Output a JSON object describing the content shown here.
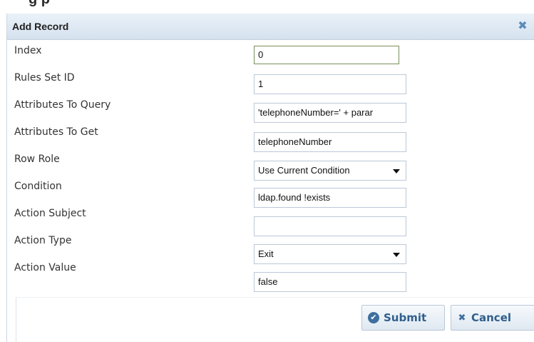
{
  "page": {
    "partial_heading": "g     p"
  },
  "dialog": {
    "title": "Add Record",
    "close_icon": "close-icon"
  },
  "fields": [
    {
      "label": "Index",
      "value": "0",
      "type": "text"
    },
    {
      "label": "Rules Set ID",
      "value": "1",
      "type": "text"
    },
    {
      "label": "Attributes To Query",
      "value": "'telephoneNumber=' + parar",
      "type": "text"
    },
    {
      "label": "Attributes To Get",
      "value": "telephoneNumber",
      "type": "text"
    },
    {
      "label": "Row Role",
      "value": "Use Current Condition",
      "type": "select"
    },
    {
      "label": "Condition",
      "value": "ldap.found !exists",
      "type": "text"
    },
    {
      "label": "Action Subject",
      "value": "",
      "type": "text"
    },
    {
      "label": "Action Type",
      "value": "Exit",
      "type": "select"
    },
    {
      "label": "Action Value",
      "value": "false",
      "type": "text"
    }
  ],
  "buttons": {
    "submit_label": "Submit",
    "cancel_label": "Cancel"
  },
  "colors": {
    "header_bg": "#d5e2ef",
    "accent": "#3f6f9e",
    "button_text": "#2f5f8c"
  }
}
